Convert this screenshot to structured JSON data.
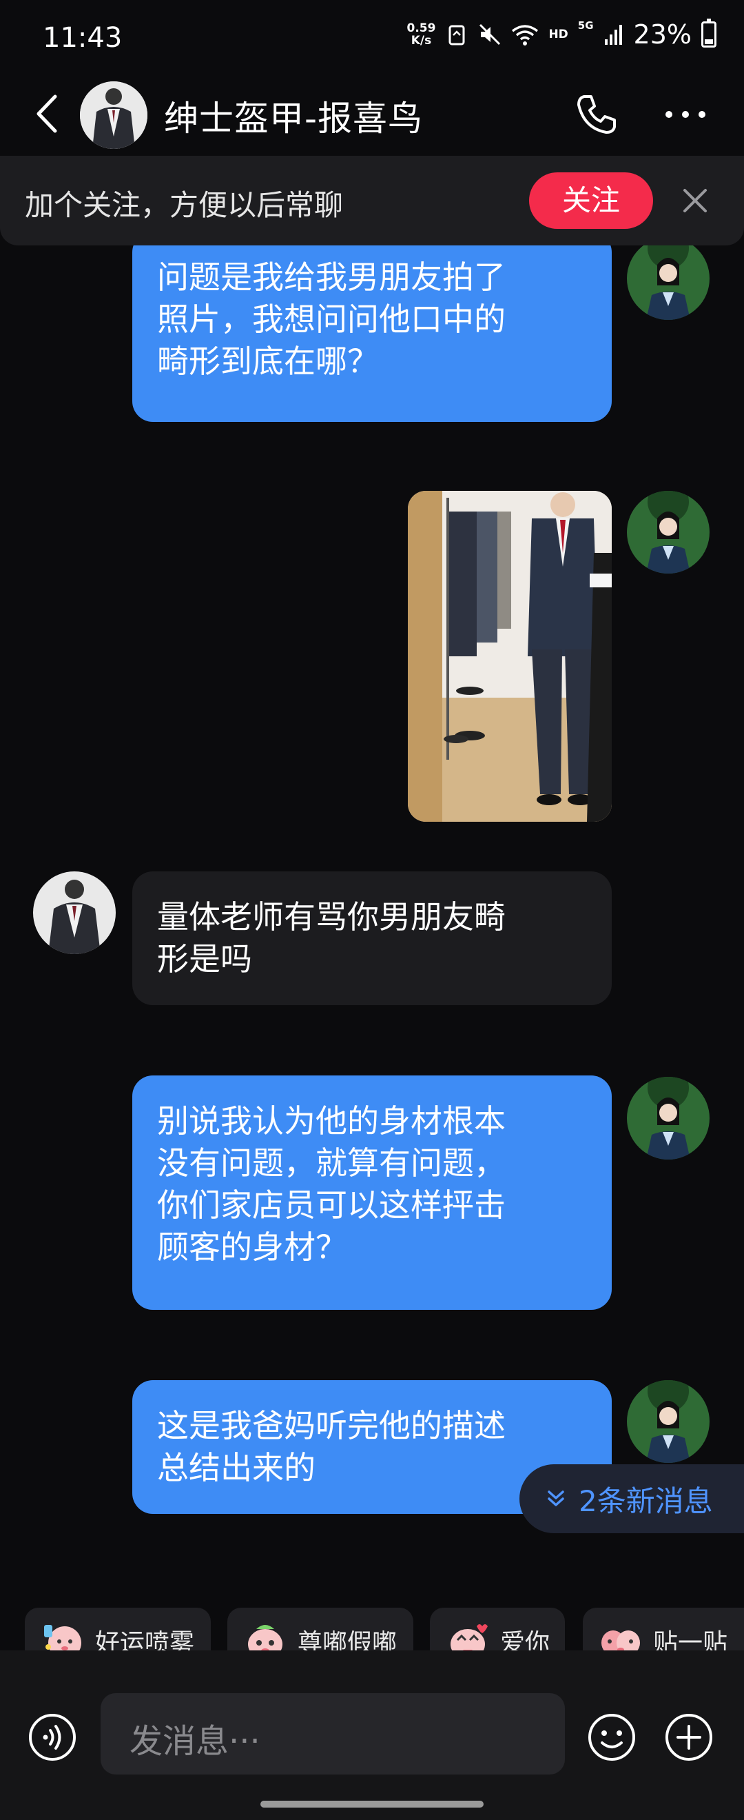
{
  "status_bar": {
    "time": "11:43",
    "net_speed_value": "0.59",
    "net_speed_unit": "K/s",
    "hd": "HD",
    "network": "5G",
    "battery": "23%"
  },
  "header": {
    "title": "绅士盔甲-报喜鸟",
    "icons": [
      "back-arrow-icon",
      "shop-avatar",
      "phone-icon",
      "more-icon"
    ]
  },
  "follow_banner": {
    "text": "加个关注，方便以后常聊",
    "button": "关注"
  },
  "messages": [
    {
      "side": "out",
      "type": "text",
      "lines": [
        "问题是我给我男朋友拍了",
        "照片，我想问问他口中的",
        "畸形到底在哪？"
      ]
    },
    {
      "side": "out",
      "type": "image",
      "desc": "man-in-suit-photo"
    },
    {
      "side": "in",
      "type": "text",
      "lines": [
        "量体老师有骂你男朋友畸",
        "形是吗"
      ]
    },
    {
      "side": "out",
      "type": "text",
      "lines": [
        "别说我认为他的身材根本",
        "没有问题，就算有问题，",
        "你们家店员可以这样抨击",
        "顾客的身材？"
      ]
    },
    {
      "side": "out",
      "type": "text",
      "lines": [
        "这是我爸妈听完他的描述",
        "总结出来的"
      ]
    }
  ],
  "new_messages": "2条新消息",
  "quick_reactions": [
    {
      "label": "好运喷雾"
    },
    {
      "label": "尊嘟假嘟"
    },
    {
      "label": "爱你"
    },
    {
      "label": "贴一贴"
    }
  ],
  "input": {
    "placeholder": "发消息···"
  },
  "colors": {
    "background": "#0b0b0d",
    "outgoing_bubble": "#3e8cf5",
    "incoming_bubble": "#1c1c1f",
    "follow_button": "#f42b4b",
    "new_message_text": "#4f94ff"
  }
}
